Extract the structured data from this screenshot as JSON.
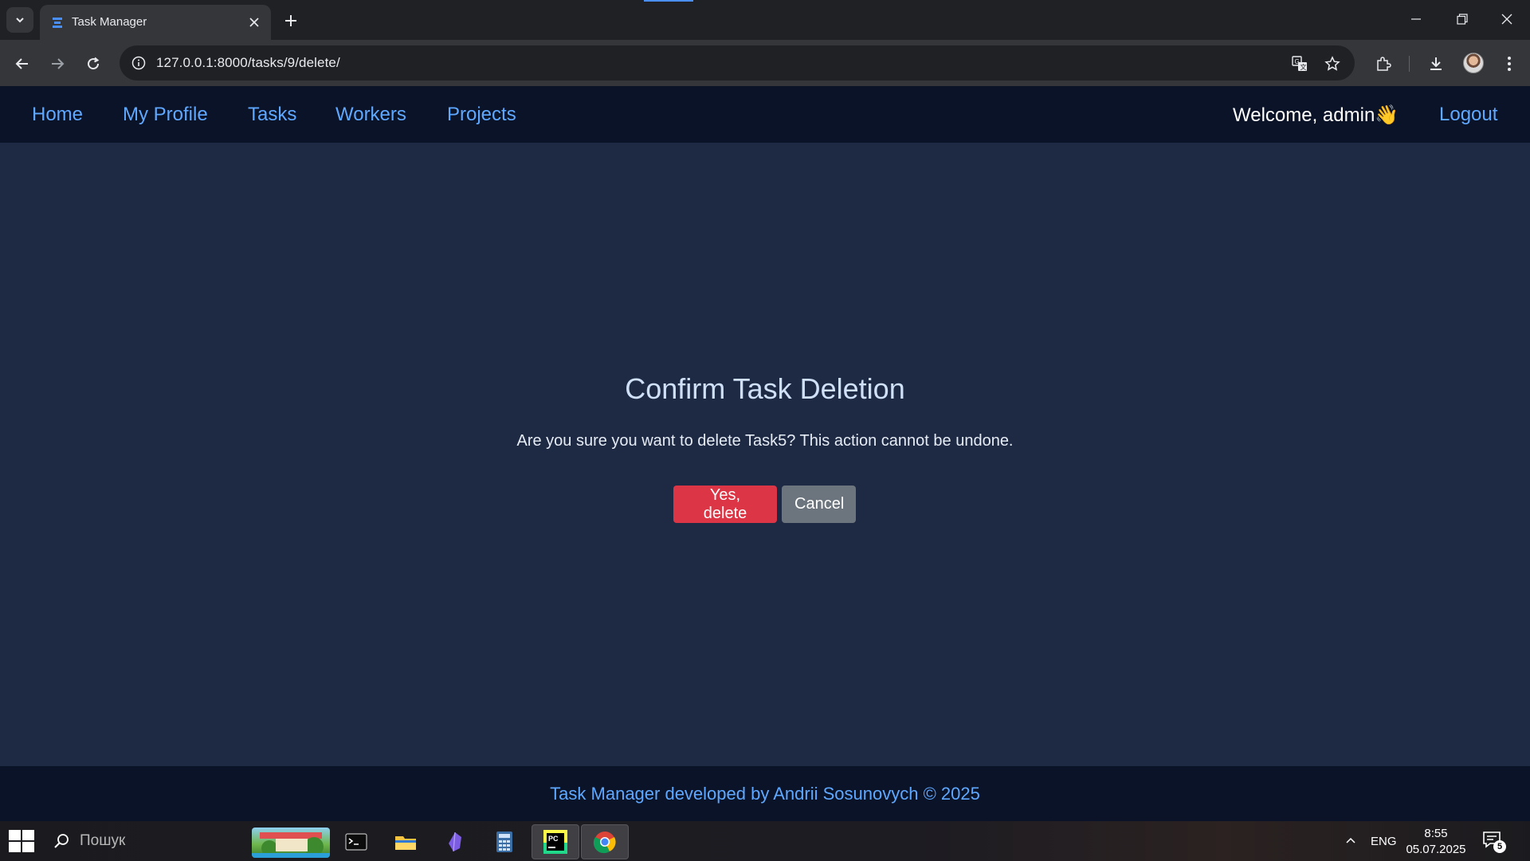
{
  "browser": {
    "tab_title": "Task Manager",
    "url": "127.0.0.1:8000/tasks/9/delete/"
  },
  "navbar": {
    "links": [
      "Home",
      "My Profile",
      "Tasks",
      "Workers",
      "Projects"
    ],
    "welcome": "Welcome, admin👋",
    "logout": "Logout"
  },
  "main": {
    "title": "Confirm Task Deletion",
    "message": "Are you sure you want to delete Task5? This action cannot be undone.",
    "confirm_label": "Yes, delete",
    "cancel_label": "Cancel"
  },
  "footer": {
    "text": "Task Manager developed by Andrii Sosunovych © 2025"
  },
  "taskbar": {
    "search_placeholder": "Пошук",
    "language": "ENG",
    "time": "8:55",
    "date": "05.07.2025",
    "notification_count": "5"
  },
  "colors": {
    "page_bg": "#1e2a44",
    "navbar_bg": "#0b1328",
    "link": "#5fa8ff",
    "danger": "#dc3545",
    "secondary": "#6c757d"
  }
}
